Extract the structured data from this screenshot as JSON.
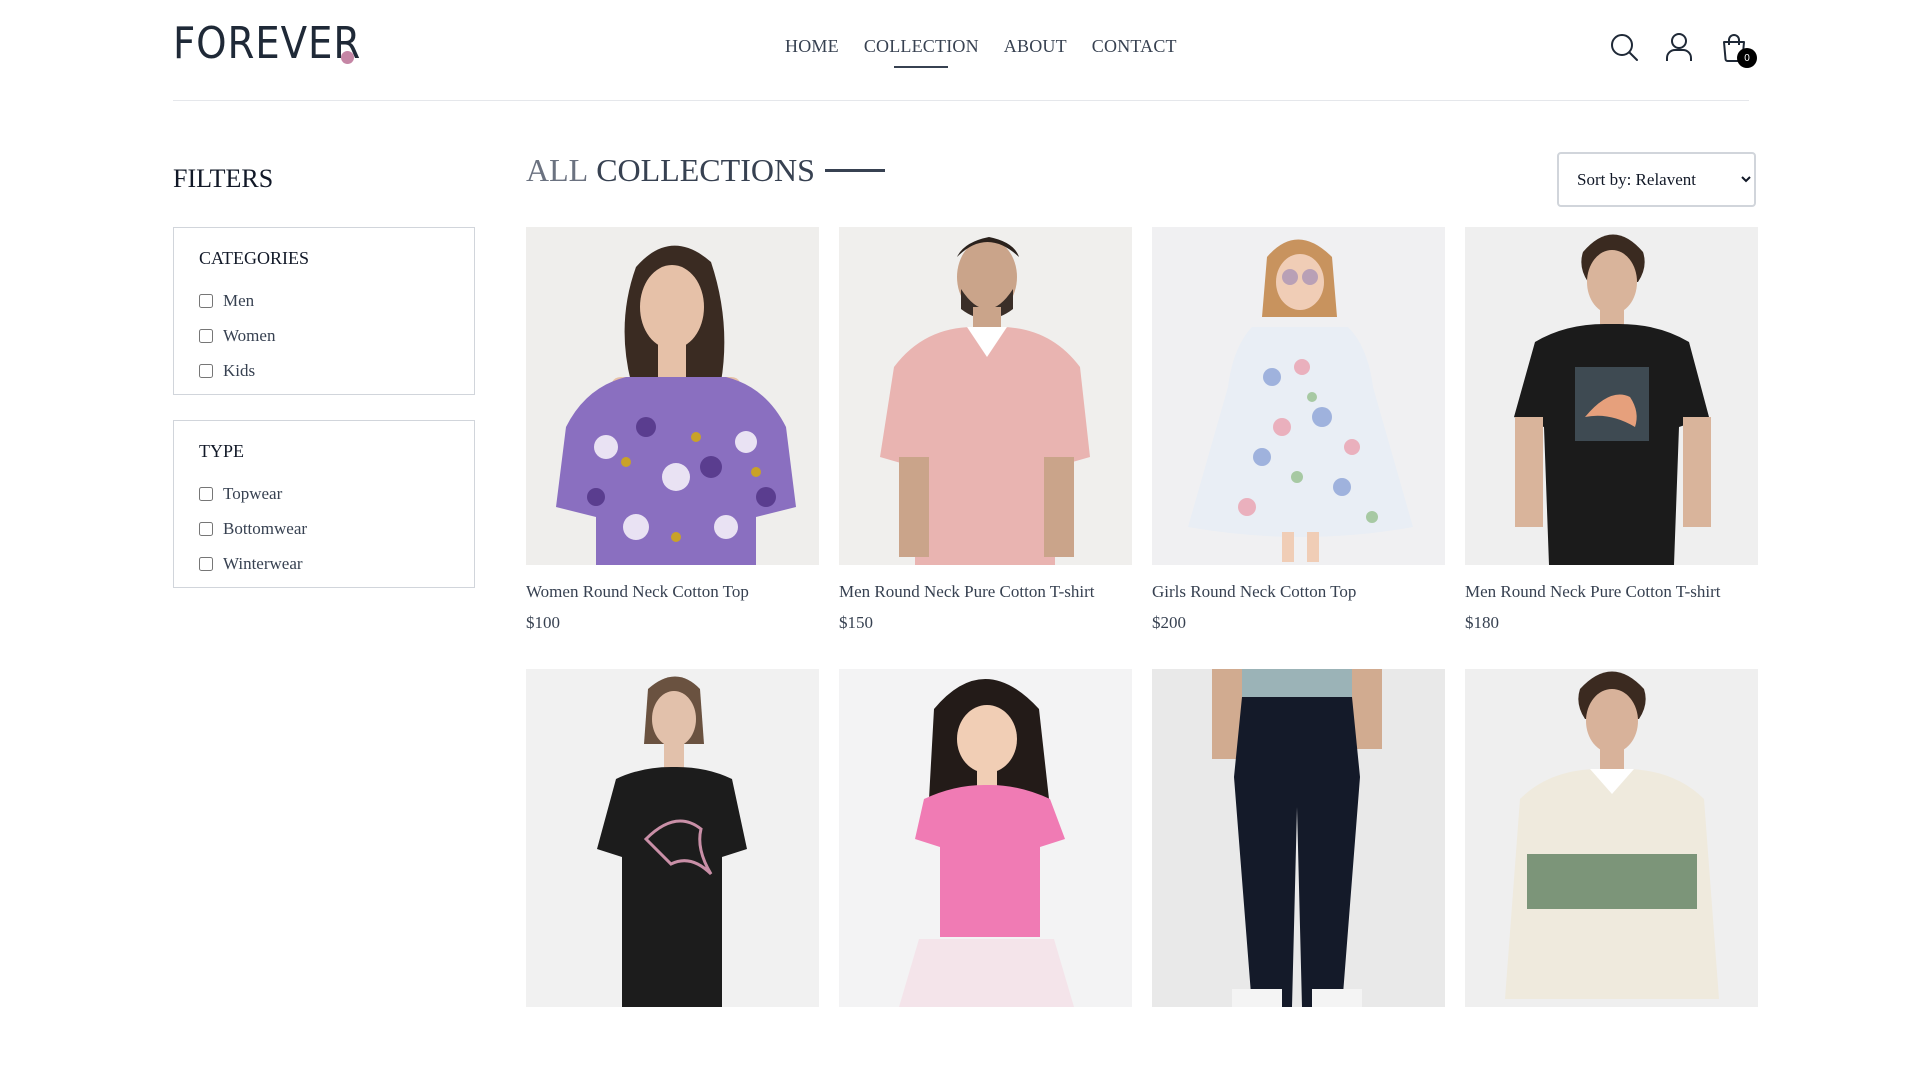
{
  "brand": {
    "logo_text": "FOREVER",
    "dot_color": "#c586a5"
  },
  "nav": [
    {
      "label": "HOME",
      "active": false
    },
    {
      "label": "COLLECTION",
      "active": true
    },
    {
      "label": "ABOUT",
      "active": false
    },
    {
      "label": "CONTACT",
      "active": false
    }
  ],
  "header_icons": {
    "search": "search-icon",
    "profile": "profile-icon",
    "cart": "cart-icon",
    "cart_count": "0"
  },
  "sidebar": {
    "title": "FILTERS",
    "categories": {
      "heading": "CATEGORIES",
      "options": [
        "Men",
        "Women",
        "Kids"
      ]
    },
    "type": {
      "heading": "TYPE",
      "options": [
        "Topwear",
        "Bottomwear",
        "Winterwear"
      ]
    }
  },
  "main": {
    "title_light": "ALL",
    "title_dark": "COLLECTIONS",
    "sort": {
      "selected": "Sort by: Relavent"
    }
  },
  "products": [
    {
      "name": "Women Round Neck Cotton Top",
      "price": "$100"
    },
    {
      "name": "Men Round Neck Pure Cotton T-shirt",
      "price": "$150"
    },
    {
      "name": "Girls Round Neck Cotton Top",
      "price": "$200"
    },
    {
      "name": "Men Round Neck Pure Cotton T-shirt",
      "price": "$180"
    },
    {
      "name": "",
      "price": ""
    },
    {
      "name": "",
      "price": ""
    },
    {
      "name": "",
      "price": ""
    },
    {
      "name": "",
      "price": ""
    }
  ]
}
